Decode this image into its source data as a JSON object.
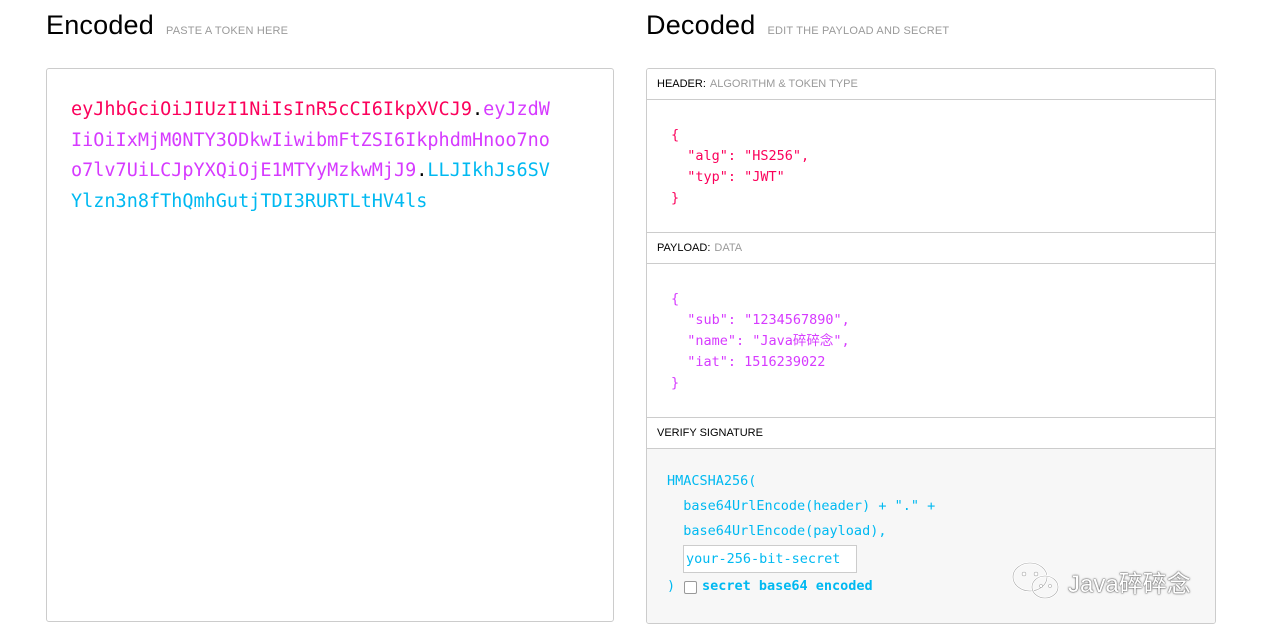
{
  "encoded": {
    "title": "Encoded",
    "subtitle": "PASTE A TOKEN HERE",
    "token": {
      "header_part": "eyJhbGciOiJIUzI1NiIsInR5cCI6IkpXVCJ9",
      "payload_part": "eyJzdWIiOiIxMjM0NTY3ODkwIiwibmFtZSI6IkphdmHnoo7noo7lv7UiLCJpYXQiOjE1MTYyMzkwMjJ9",
      "signature_part": "LLJIkhJs6SVYlzn3n8fThQmhGutjTDI3RURTLtHV4ls",
      "separator": "."
    }
  },
  "decoded": {
    "title": "Decoded",
    "subtitle": "EDIT THE PAYLOAD AND SECRET",
    "header_section": {
      "label": "HEADER:",
      "sublabel": "ALGORITHM & TOKEN TYPE",
      "lines": [
        "{",
        "  \"alg\": \"HS256\",",
        "  \"typ\": \"JWT\"",
        "}"
      ]
    },
    "payload_section": {
      "label": "PAYLOAD:",
      "sublabel": "DATA",
      "lines": [
        "{",
        "  \"sub\": \"1234567890\",",
        "  \"name\": \"Java碎碎念\",",
        "  \"iat\": 1516239022",
        "}"
      ]
    },
    "verify_section": {
      "label": "VERIFY SIGNATURE",
      "fn_open": "HMACSHA256(",
      "arg1": "  base64UrlEncode(header) + \".\" +",
      "arg2": "  base64UrlEncode(payload),",
      "secret_value": "your-256-bit-secret",
      "fn_close": ")",
      "base64_label": "secret base64 encoded",
      "base64_checked": false
    }
  },
  "watermark": {
    "text": "Java碎碎念",
    "icon": "wechat-icon"
  },
  "colors": {
    "header": "#fb015b",
    "payload": "#d63aff",
    "signature": "#00b9f1"
  }
}
